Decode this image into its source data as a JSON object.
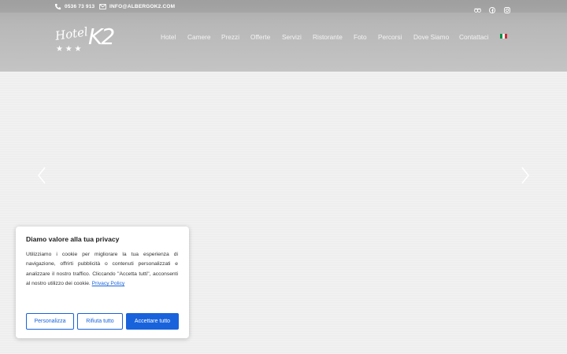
{
  "header": {
    "phone": "0536 73 913",
    "email": "INFO@ALBERGOK2.COM",
    "social_icons": [
      "tripadvisor-icon",
      "facebook-icon",
      "instagram-icon"
    ],
    "logo": {
      "word": "Hotel",
      "mark": "K2",
      "stars": "★ ★ ★"
    },
    "nav": [
      "Hotel",
      "Camere",
      "Prezzi",
      "Offerte",
      "Servizi",
      "Ristorante",
      "Foto",
      "Percorsi",
      "Dove Siamo",
      "Contattaci"
    ],
    "language_flag": "italian-flag-icon"
  },
  "slider": {
    "prev_icon": "chevron-left-icon",
    "next_icon": "chevron-right-icon"
  },
  "cookie": {
    "title": "Diamo valore alla tua privacy",
    "text": "Utilizziamo i cookie per migliorare la tua esperienza di navigazione, offrirti pubblicità o contenuti personalizzati e analizzare il nostro traffico. Cliccando \"Accetta tutti\", acconsenti al nostro utilizzo dei cookie.",
    "policy_link": "Privacy Policy",
    "buttons": {
      "customize": "Personalizza",
      "reject": "Rifiuta tutto",
      "accept": "Accettare tutto"
    }
  },
  "colors": {
    "accent": "#1863dc",
    "header_bg": "#b8b8b8",
    "page_bg": "#eeeeee"
  }
}
